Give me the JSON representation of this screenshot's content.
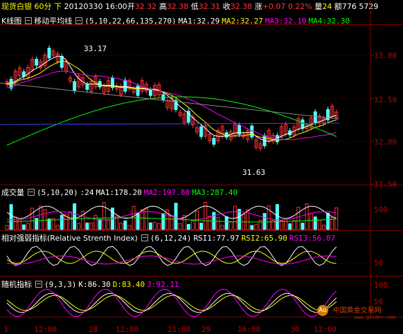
{
  "topbar": {
    "instrument": "现货白银",
    "period": "60分",
    "direction": "下",
    "datetime": "20120330 16:00",
    "open_label": "开",
    "open": "32.32",
    "high_label": "高",
    "high": "32.38",
    "low_label": "低",
    "low": "32.31",
    "close_label": "收",
    "close": "32.38",
    "change_label": "涨",
    "change": "+0.07",
    "change_pct": "0.22%",
    "volume_label": "量",
    "volume": "24",
    "amount_label": "额",
    "amount": "776 5729"
  },
  "price_panel": {
    "title": "K线图",
    "indicator": "移动平均线",
    "params": "(5,10,22,66,135,270)",
    "ma1": "MA1:32.29",
    "ma2": "MA2:32.27",
    "ma3": "MA3:32.10",
    "ma4": "MA4:32.30",
    "high_annotation": "33.17",
    "low_annotation": "31.63",
    "yticks": [
      "33.00",
      "32.50",
      "32.00",
      "31.50"
    ]
  },
  "volume_panel": {
    "title": "成交量",
    "params": "(5,10,20)",
    "value": ":24",
    "ma1": "MA1:178.20",
    "ma2": "MA2:197.80",
    "ma3": "MA3:287.40",
    "yticks": [
      "500"
    ]
  },
  "rsi_panel": {
    "title": "相对强弱指标(Relative Strenth Index)",
    "params": "(6,12,24)",
    "rsi1": "RSI1:77.97",
    "rsi2": "RSI2:65.90",
    "rsi3": "RSI3:56.07",
    "yticks": [
      "50"
    ]
  },
  "kdj_panel": {
    "title": "随机指标",
    "params": "(9,3,3)",
    "k": "K:86.30",
    "d": "D:83.40",
    "j": "J:92.11",
    "yticks": [
      "100",
      "50"
    ]
  },
  "xaxis": {
    "ticks": [
      "3",
      "12:00",
      "28",
      "12:00",
      "21:00",
      "29",
      "16:00",
      "30",
      "12:00"
    ]
  },
  "watermark": {
    "cn": "中国黄金交易网",
    "url": "www.goldtr.com"
  },
  "colors": {
    "up": "#ff3232",
    "down": "#54ffff",
    "ma1": "#ffffff",
    "ma2": "#ffff00",
    "ma3": "#ff00ff",
    "ma4": "#00ff00",
    "grid": "#800000",
    "axis_text": "#c00000"
  }
}
